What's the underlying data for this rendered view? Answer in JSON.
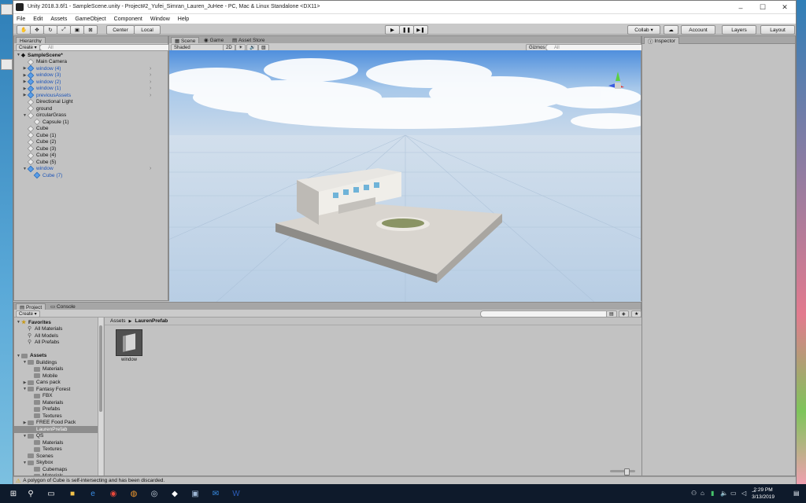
{
  "window": {
    "title": "Unity 2018.3.6f1 - SampleScene.unity - Project#2_Yufei_Simran_Lauren_JuHee - PC, Mac & Linux Standalone <DX11>",
    "controls": [
      "–",
      "☐",
      "✕"
    ]
  },
  "menu": [
    "File",
    "Edit",
    "Assets",
    "GameObject",
    "Component",
    "Window",
    "Help"
  ],
  "toolbar": {
    "pivot": "Center",
    "space": "Local",
    "collab": "Collab ▾",
    "account": "Account",
    "layers": "Layers",
    "layout": "Layout"
  },
  "hierarchy": {
    "tab": "Hierarchy",
    "create": "Create ▾",
    "search_placeholder": "All",
    "scene": "SampleScene*",
    "items": [
      {
        "label": "Main Camera",
        "indent": 1,
        "arrow": "",
        "prefab": false
      },
      {
        "label": "window (4)",
        "indent": 1,
        "arrow": "▶",
        "prefab": true
      },
      {
        "label": "window (3)",
        "indent": 1,
        "arrow": "▶",
        "prefab": true
      },
      {
        "label": "window (2)",
        "indent": 1,
        "arrow": "▶",
        "prefab": true
      },
      {
        "label": "window (1)",
        "indent": 1,
        "arrow": "▶",
        "prefab": true
      },
      {
        "label": "previousAssets",
        "indent": 1,
        "arrow": "▶",
        "prefab": true
      },
      {
        "label": "Directional Light",
        "indent": 1,
        "arrow": "",
        "prefab": false
      },
      {
        "label": "ground",
        "indent": 1,
        "arrow": "",
        "prefab": false
      },
      {
        "label": "circularGrass",
        "indent": 1,
        "arrow": "▼",
        "prefab": false
      },
      {
        "label": "Capsule (1)",
        "indent": 2,
        "arrow": "",
        "prefab": false
      },
      {
        "label": "Cube",
        "indent": 1,
        "arrow": "",
        "prefab": false
      },
      {
        "label": "Cube (1)",
        "indent": 1,
        "arrow": "",
        "prefab": false
      },
      {
        "label": "Cube (2)",
        "indent": 1,
        "arrow": "",
        "prefab": false
      },
      {
        "label": "Cube (3)",
        "indent": 1,
        "arrow": "",
        "prefab": false
      },
      {
        "label": "Cube (4)",
        "indent": 1,
        "arrow": "",
        "prefab": false
      },
      {
        "label": "Cube (5)",
        "indent": 1,
        "arrow": "",
        "prefab": false
      },
      {
        "label": "window",
        "indent": 1,
        "arrow": "▼",
        "prefab": true
      },
      {
        "label": "Cube (7)",
        "indent": 2,
        "arrow": "",
        "prefab": true
      }
    ]
  },
  "scene": {
    "tabs": [
      "Scene",
      "Game",
      "Asset Store"
    ],
    "shading": "Shaded",
    "mode_2d": "2D",
    "gizmos": "Gizmos ▾",
    "search_placeholder": "All"
  },
  "inspector": {
    "tab": "Inspector"
  },
  "project": {
    "tabs": [
      "Project",
      "Console"
    ],
    "create": "Create ▾",
    "breadcrumb_root": "Assets",
    "breadcrumb_sep": "▶",
    "breadcrumb_current": "LaurenPrefab",
    "tree": [
      {
        "label": "Favorites",
        "indent": 0,
        "arrow": "▼",
        "kind": "star",
        "bold": true
      },
      {
        "label": "All Materials",
        "indent": 1,
        "arrow": "",
        "kind": "search",
        "bold": false
      },
      {
        "label": "All Models",
        "indent": 1,
        "arrow": "",
        "kind": "search",
        "bold": false
      },
      {
        "label": "All Prefabs",
        "indent": 1,
        "arrow": "",
        "kind": "search",
        "bold": false
      },
      {
        "label": "",
        "indent": 0,
        "arrow": "",
        "kind": "gap",
        "bold": false
      },
      {
        "label": "Assets",
        "indent": 0,
        "arrow": "▼",
        "kind": "folder",
        "bold": true
      },
      {
        "label": "Buildings",
        "indent": 1,
        "arrow": "▼",
        "kind": "folder",
        "bold": false
      },
      {
        "label": "Materials",
        "indent": 2,
        "arrow": "",
        "kind": "folder",
        "bold": false
      },
      {
        "label": "Mobile",
        "indent": 2,
        "arrow": "",
        "kind": "folder",
        "bold": false
      },
      {
        "label": "Cans pack",
        "indent": 1,
        "arrow": "▶",
        "kind": "folder",
        "bold": false
      },
      {
        "label": "Fantasy Forest",
        "indent": 1,
        "arrow": "▼",
        "kind": "folder",
        "bold": false
      },
      {
        "label": "FBX",
        "indent": 2,
        "arrow": "",
        "kind": "folder",
        "bold": false
      },
      {
        "label": "Materials",
        "indent": 2,
        "arrow": "",
        "kind": "folder",
        "bold": false
      },
      {
        "label": "Prefabs",
        "indent": 2,
        "arrow": "",
        "kind": "folder",
        "bold": false
      },
      {
        "label": "Textures",
        "indent": 2,
        "arrow": "",
        "kind": "folder",
        "bold": false
      },
      {
        "label": "FREE Food Pack",
        "indent": 1,
        "arrow": "▶",
        "kind": "folder",
        "bold": false
      },
      {
        "label": "LaurenPrefab",
        "indent": 1,
        "arrow": "",
        "kind": "folder",
        "bold": false,
        "selected": true
      },
      {
        "label": "QS",
        "indent": 1,
        "arrow": "▼",
        "kind": "folder",
        "bold": false
      },
      {
        "label": "Materials",
        "indent": 2,
        "arrow": "",
        "kind": "folder",
        "bold": false
      },
      {
        "label": "Textures",
        "indent": 2,
        "arrow": "",
        "kind": "folder",
        "bold": false
      },
      {
        "label": "Scenes",
        "indent": 1,
        "arrow": "",
        "kind": "folder",
        "bold": false
      },
      {
        "label": "Skybox",
        "indent": 1,
        "arrow": "▼",
        "kind": "folder",
        "bold": false
      },
      {
        "label": "Cubemaps",
        "indent": 2,
        "arrow": "",
        "kind": "folder",
        "bold": false
      },
      {
        "label": "Materials",
        "indent": 2,
        "arrow": "",
        "kind": "folder",
        "bold": false
      }
    ],
    "asset": {
      "label": "window"
    }
  },
  "status": {
    "message": "A polygon of Cube is self-intersecting and has been discarded."
  },
  "taskbar": {
    "clock_time": "2:29 PM",
    "clock_date": "3/13/2019",
    "icons": [
      "windows-start-icon",
      "search-icon",
      "task-view-icon",
      "file-explorer-icon",
      "edge-icon",
      "chrome-icon",
      "firefox-icon",
      "steam-icon",
      "unity-icon",
      "unity-hub-icon",
      "mail-icon",
      "word-icon"
    ]
  },
  "colors": {
    "accent": "#1c54b8",
    "scene_sky": "#7fb6ea",
    "taskbar": "#0e1a2b"
  }
}
